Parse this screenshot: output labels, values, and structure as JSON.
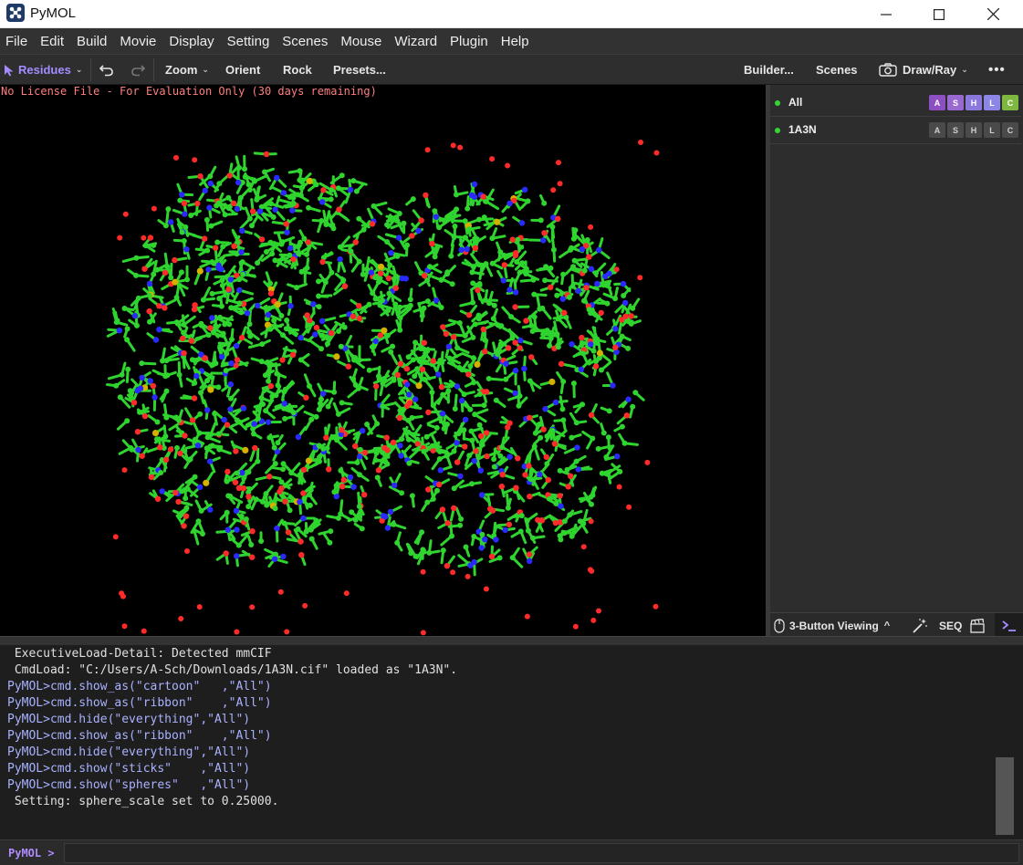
{
  "window": {
    "title": "PyMOL",
    "icons": {
      "app": "pymol-logo-icon",
      "minimize": "minimize-icon",
      "maximize": "maximize-icon",
      "close": "close-icon"
    }
  },
  "menu": [
    "File",
    "Edit",
    "Build",
    "Movie",
    "Display",
    "Setting",
    "Scenes",
    "Mouse",
    "Wizard",
    "Plugin",
    "Help"
  ],
  "toolbar": {
    "selection_mode": "Residues",
    "zoom": "Zoom",
    "orient": "Orient",
    "rock": "Rock",
    "presets": "Presets...",
    "builder": "Builder...",
    "scenes": "Scenes",
    "draw_ray": "Draw/Ray",
    "more": "•••",
    "icons": {
      "pointer": "cursor-arrow-icon",
      "undo": "undo-icon",
      "redo": "redo-icon",
      "camera": "camera-icon"
    }
  },
  "viewport": {
    "license_notice": "No License File - For Evaluation Only (30 days remaining)",
    "colors": {
      "carbon": "#2fd42f",
      "oxygen": "#ff2a2a",
      "nitrogen": "#2a2aff",
      "sulfur": "#d4b000",
      "background": "#000000"
    }
  },
  "objects": [
    {
      "name": "All",
      "buttons": [
        "A",
        "S",
        "H",
        "L",
        "C"
      ],
      "colored": true
    },
    {
      "name": "1A3N",
      "buttons": [
        "A",
        "S",
        "H",
        "L",
        "C"
      ],
      "colored": false
    }
  ],
  "button_colors": {
    "A": "#8d4fc2",
    "S": "#9a68d1",
    "H": "#8a78dc",
    "L": "#8c86e6",
    "C": "#7fb841",
    "inactive": "#4a4a4a"
  },
  "panel_bottom": {
    "mouse_mode": "3-Button Viewing",
    "seq": "SEQ",
    "icons": {
      "mouse": "mouse-icon",
      "wand": "magic-wand-icon",
      "movie": "movie-clapper-icon",
      "terminal": "terminal-icon"
    }
  },
  "console": {
    "lines": [
      {
        "text": " ExecutiveLoad-Detail: Detected mmCIF",
        "cmd": false
      },
      {
        "text": " CmdLoad: \"C:/Users/A-Sch/Downloads/1A3N.cif\" loaded as \"1A3N\".",
        "cmd": false
      },
      {
        "text": "PyMOL>cmd.show_as(\"cartoon\"   ,\"All\")",
        "cmd": true
      },
      {
        "text": "PyMOL>cmd.show_as(\"ribbon\"    ,\"All\")",
        "cmd": true
      },
      {
        "text": "PyMOL>cmd.hide(\"everything\",\"All\")",
        "cmd": true
      },
      {
        "text": "PyMOL>cmd.show_as(\"ribbon\"    ,\"All\")",
        "cmd": true
      },
      {
        "text": "PyMOL>cmd.hide(\"everything\",\"All\")",
        "cmd": true
      },
      {
        "text": "PyMOL>cmd.show(\"sticks\"    ,\"All\")",
        "cmd": true
      },
      {
        "text": "PyMOL>cmd.show(\"spheres\"   ,\"All\")",
        "cmd": true
      },
      {
        "text": " Setting: sphere_scale set to 0.25000.",
        "cmd": false
      }
    ],
    "prompt": "PyMOL >",
    "input_value": ""
  }
}
